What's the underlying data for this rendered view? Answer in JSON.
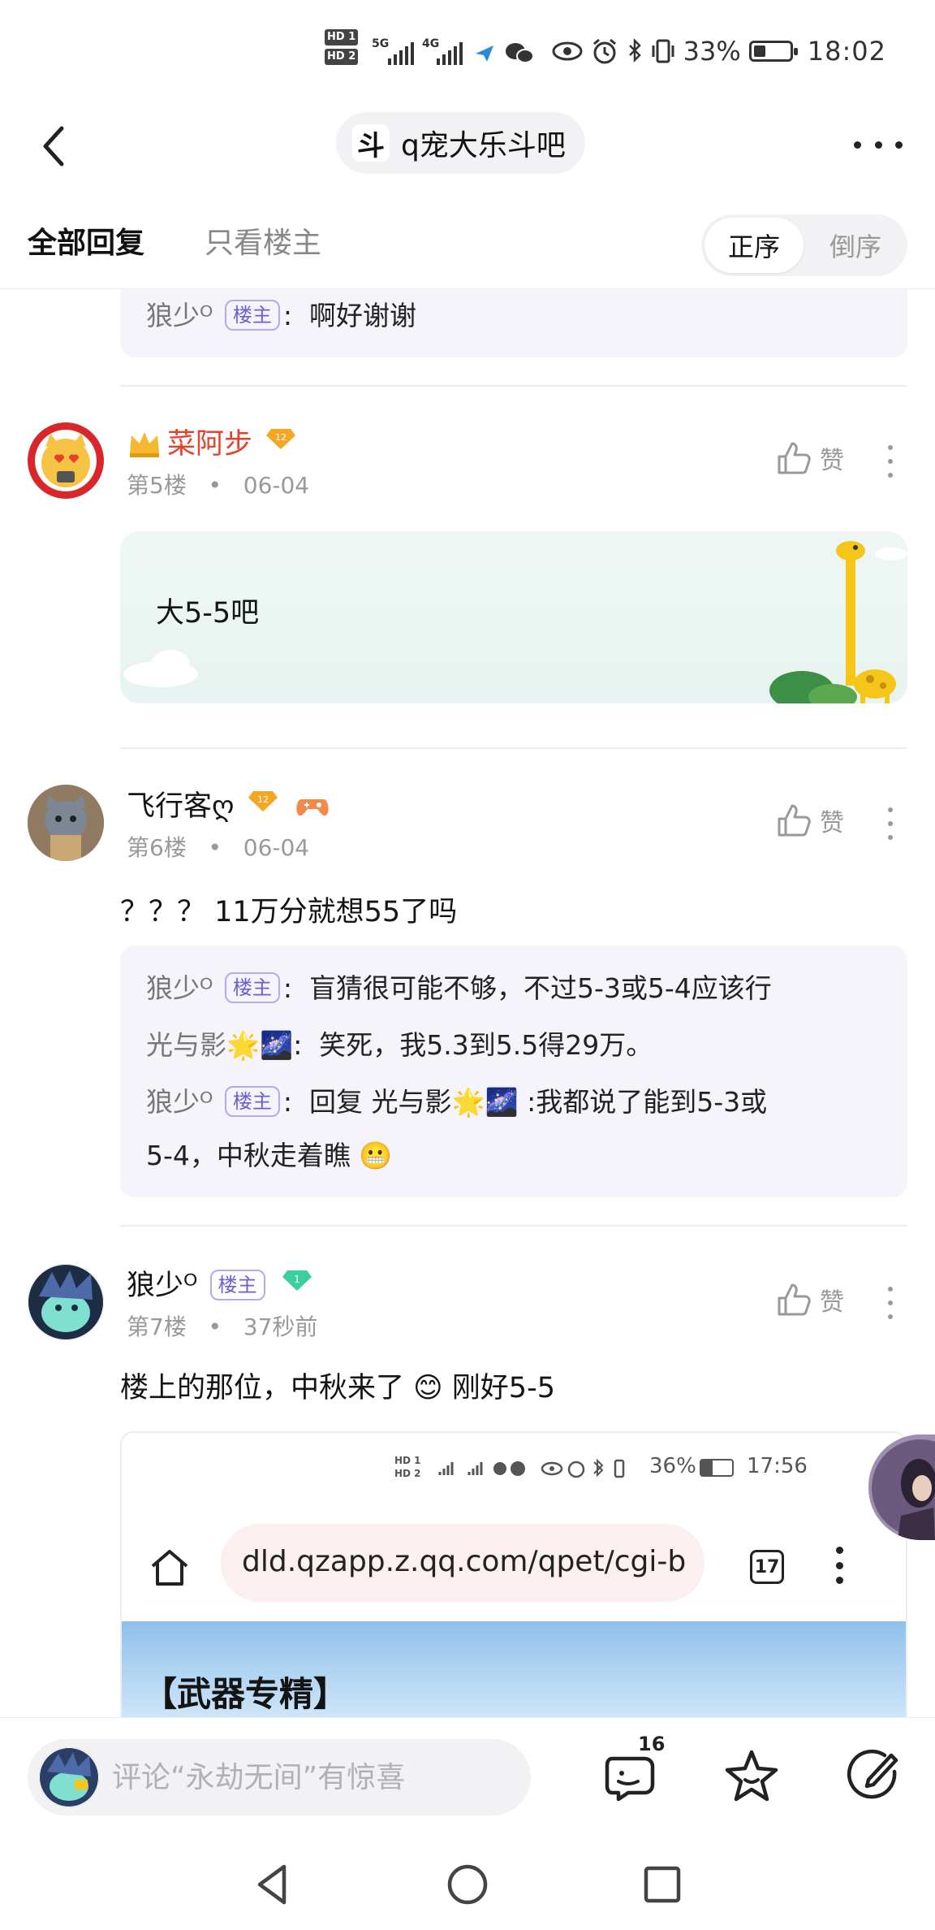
{
  "status_bar": {
    "hd1": "HD 1",
    "hd2": "HD 2",
    "net1": "5G",
    "net2": "4G",
    "battery_percent": "33%",
    "time": "18:02"
  },
  "nav": {
    "forum_icon": "斗",
    "forum_name": "q宠大乐斗吧"
  },
  "tabs": {
    "all_replies": "全部回复",
    "only_op": "只看楼主",
    "sort_asc": "正序",
    "sort_desc": "倒序"
  },
  "top_subreply": {
    "name": "狼少ᴼ",
    "badge": "楼主",
    "sep": ":",
    "text": "啊好谢谢"
  },
  "posts": [
    {
      "username": "菜阿步",
      "level": "12",
      "floor": "第5楼",
      "dot": "•",
      "date": "06-04",
      "like_label": "赞",
      "content": "大5-5吧"
    },
    {
      "username": "飞行客ღ",
      "level": "12",
      "floor": "第6楼",
      "dot": "•",
      "date": "06-04",
      "like_label": "赞",
      "content": "？？？ 11万分就想55了吗",
      "replies": [
        {
          "name": "狼少ᴼ",
          "badge": "楼主",
          "sep": ":",
          "text": "盲猜很可能不够，不过5-3或5-4应该行"
        },
        {
          "name": "光与影🌟🌌",
          "sep": ":",
          "text": "笑死，我5.3到5.5得29万。"
        },
        {
          "name": "狼少ᴼ",
          "badge": "楼主",
          "sep": ":",
          "text": "回复 光与影🌟🌌 :我都说了能到5-3或",
          "text2": "5-4，中秋走着瞧 😬"
        }
      ]
    },
    {
      "username": "狼少ᴼ",
      "badge": "楼主",
      "floor": "第7楼",
      "dot": "•",
      "date": "37秒前",
      "like_label": "赞",
      "content_a": "楼上的那位，中秋来了",
      "content_emoji": "😊",
      "content_b": "刚好5-5"
    }
  ],
  "embedded_screenshot": {
    "hd1": "HD 1",
    "hd2": "HD 2",
    "battery_percent": "36%",
    "time": "17:56",
    "url": "dld.qzapp.z.qq.com/qpet/cgi-b",
    "tab_count": "17",
    "heading": "【武器专精】"
  },
  "bottom_bar": {
    "comment_placeholder": "评论“永劫无间”有惊喜",
    "message_count": "16"
  },
  "colors": {
    "vip_name": "#e8412b",
    "owner_badge": "#6b5fd3",
    "gold_level": "#f5a623",
    "green_level": "#3ccf9e"
  },
  "icons": [
    "back-arrow-icon",
    "more-dots-icon",
    "thumbs-up-icon",
    "message-icon",
    "star-icon",
    "edit-icon",
    "home-icon",
    "triangle-back-icon",
    "circle-home-icon",
    "square-recents-icon"
  ]
}
